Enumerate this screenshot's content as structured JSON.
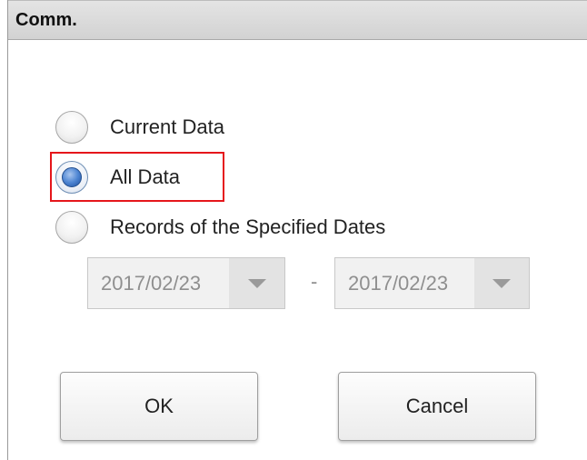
{
  "dialog": {
    "title": "Comm."
  },
  "options": {
    "current_data": {
      "label": "Current Data",
      "selected": false
    },
    "all_data": {
      "label": "All Data",
      "selected": true
    },
    "specified_dates": {
      "label": "Records of the Specified Dates",
      "selected": false
    }
  },
  "date_range": {
    "start": "2017/02/23",
    "separator": "-",
    "end": "2017/02/23",
    "enabled": false
  },
  "buttons": {
    "ok": "OK",
    "cancel": "Cancel"
  },
  "colors": {
    "highlight": "#e5161b",
    "radio_selected": "#4f86d3",
    "disabled_text": "#8f8f8f"
  }
}
